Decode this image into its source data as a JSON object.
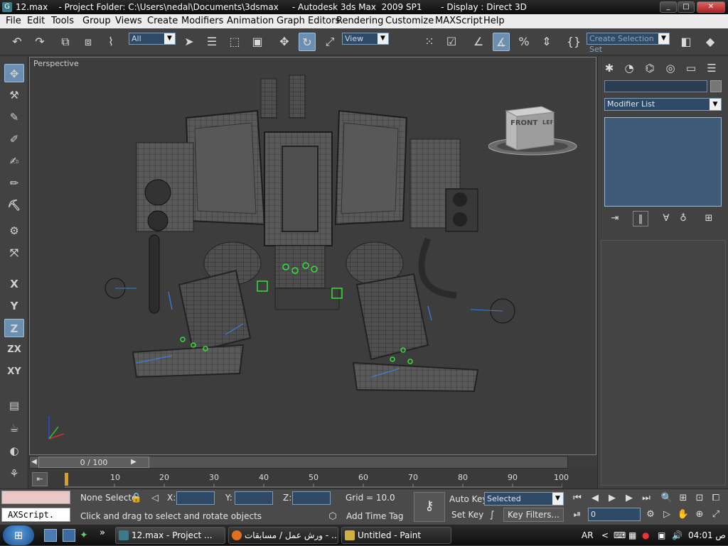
{
  "window": {
    "title": "12.max    - Project Folder: C:\\Users\\nedal\\Documents\\3dsmax     - Autodesk 3ds Max  2009 SP1       - Display : Direct 3D",
    "minimize": "_",
    "maximize": "□",
    "close": "✕"
  },
  "menu": [
    "File",
    "Edit",
    "Tools",
    "Group",
    "Views",
    "Create",
    "Modifiers",
    "Animation",
    "Graph Editors",
    "Rendering",
    "Customize",
    "MAXScript",
    "Help"
  ],
  "toolbar": {
    "selection_filter": "All",
    "reference_coord": "View",
    "named_selection_placeholder": "Create Selection Set"
  },
  "left_tools": [
    "X",
    "Y",
    "Z",
    "ZX",
    "XY"
  ],
  "viewport": {
    "label": "Perspective",
    "viewcube_front": "FRONT",
    "viewcube_left": "LEFT"
  },
  "timeline": {
    "frame_label": "0 / 100",
    "ticks": [
      "10",
      "20",
      "30",
      "40",
      "50",
      "60",
      "70",
      "80",
      "90",
      "100"
    ]
  },
  "right_panel": {
    "modifier_list": "Modifier List"
  },
  "status": {
    "maxscript_label": "AXScript.",
    "selection": "None Selecte",
    "x_label": "X:",
    "y_label": "Y:",
    "z_label": "Z:",
    "grid": "Grid = 10.0",
    "prompt": "Click and drag to select and rotate objects",
    "add_time_tag": "Add Time Tag",
    "auto_key": "Auto Key",
    "set_key": "Set Key",
    "key_mode": "Selected",
    "key_filters": "Key Filters...",
    "current_frame": "0"
  },
  "taskbar": {
    "items": [
      "12.max    - Project ...",
      "ورش عمل / مسابقات - ...",
      "Untitled - Paint"
    ],
    "lang": "AR",
    "time": "04:01 ص"
  },
  "colors": {
    "accent": "#6a8fb0",
    "field_bg": "#2f4a66",
    "swatch": "#eac8c8"
  }
}
